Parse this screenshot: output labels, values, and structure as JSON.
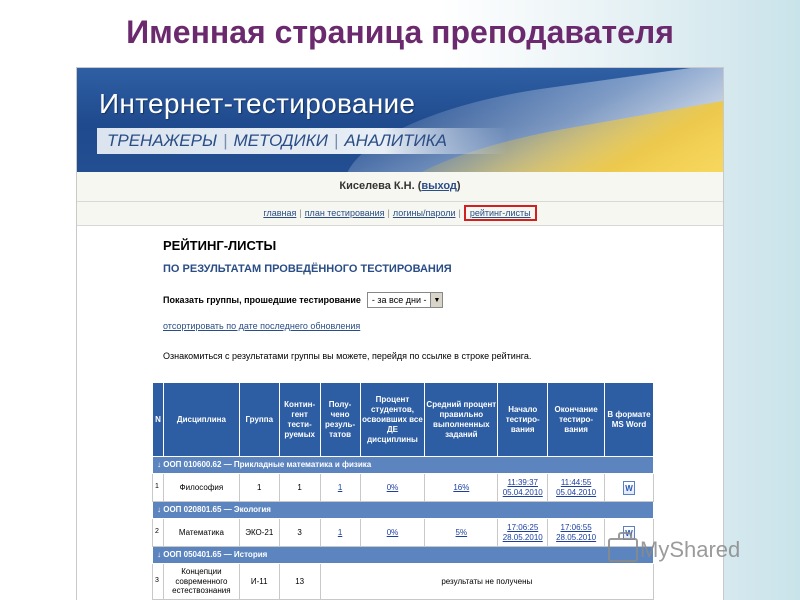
{
  "slide_title": "Именная страница преподавателя",
  "banner": {
    "title": "Интернет-тестирование",
    "menu": [
      "ТРЕНАЖЕРЫ",
      "МЕТОДИКИ",
      "АНАЛИТИКА"
    ]
  },
  "userbar": {
    "name": "Киселева К.Н. (",
    "logout": "выход",
    "close": ")"
  },
  "nav": {
    "items": [
      "главная",
      "план тестирования",
      "логины/пароли",
      "рейтинг-листы"
    ],
    "active_index": 3
  },
  "content": {
    "title": "РЕЙТИНГ-ЛИСТЫ",
    "subtitle": "ПО РЕЗУЛЬТАТАМ ПРОВЕДЁННОГО ТЕСТИРОВАНИЯ",
    "filter_label": "Показать группы, прошедшие тестирование",
    "filter_value": "- за все дни -",
    "sort_link": "отсортировать по дате последнего обновления",
    "info": "Ознакомиться с результатами группы вы можете, перейдя по ссылке в строке рейтинга."
  },
  "table": {
    "headers": [
      "N",
      "Дисциплина",
      "Группа",
      "Контин-гент тести-руемых",
      "Полу-чено резуль-татов",
      "Процент студентов, освоивших все ДЕ дисциплины",
      "Средний процент правильно выполненных заданий",
      "Начало тестиро-вания",
      "Окончание тестиро-вания",
      "В формате MS Word"
    ],
    "groups": [
      {
        "prefix": "↓ ООП ",
        "code": "010600.62",
        "name": " — Прикладные математика и физика",
        "rows": [
          {
            "n": "1",
            "discipline": "Философия",
            "group": "1",
            "contingent": "1",
            "results": "1",
            "percent_all": "0%",
            "avg_percent": "16%",
            "start": "11:39:37",
            "start_date": "05.04.2010",
            "end": "11:44:55",
            "end_date": "05.04.2010",
            "word": "W"
          }
        ]
      },
      {
        "prefix": "↓ ООП ",
        "code": "020801.65",
        "name": " — Экология",
        "rows": [
          {
            "n": "2",
            "discipline": "Математика",
            "group": "ЭКО-21",
            "contingent": "3",
            "results": "1",
            "percent_all": "0%",
            "avg_percent": "5%",
            "start": "17:06:25",
            "start_date": "28.05.2010",
            "end": "17:06:55",
            "end_date": "28.05.2010",
            "word": "W"
          }
        ]
      },
      {
        "prefix": "↓ ООП ",
        "code": "050401.65",
        "name": " — История",
        "rows": [
          {
            "n": "3",
            "discipline": "Концепции современного естествознания",
            "group": "И-11",
            "contingent": "13",
            "no_results": "результаты не получены"
          }
        ]
      }
    ]
  },
  "watermark": "MyShared"
}
